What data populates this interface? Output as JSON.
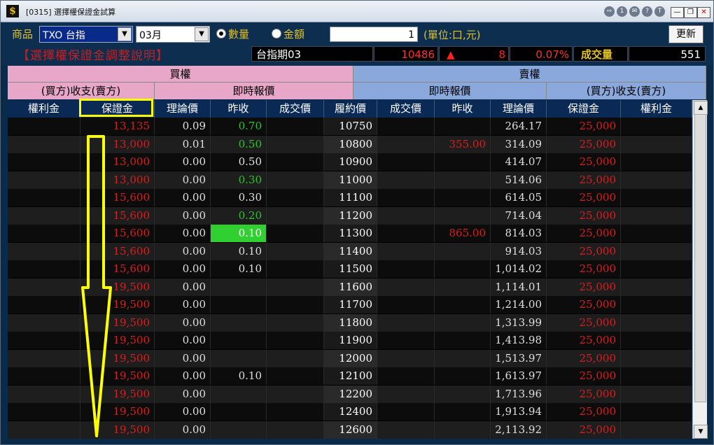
{
  "window": {
    "title": "[0315] 選擇權保證金試算",
    "title_buttons": [
      "⇨",
      "1",
      "✉",
      "?",
      "T"
    ],
    "controls": [
      "—",
      "❐",
      "✕"
    ]
  },
  "toolbar": {
    "product_label": "商品",
    "product_value": "TXO 台指",
    "month_value": "03月",
    "radio_qty": "數量",
    "radio_amount": "金額",
    "qty_value": "1",
    "unit_label": "(單位:口,元)",
    "refresh_label": "更新"
  },
  "status": {
    "notice": "【選擇權保證金調整說明】",
    "contract": "台指期03",
    "price": "10486",
    "arrow": "▲",
    "change": "8",
    "pct": "0.07%",
    "vol_label": "成交量",
    "volume": "551"
  },
  "headers": {
    "call": "買權",
    "put": "賣權",
    "call_cash": "(買方)收支(賣方)",
    "call_quote": "即時報價",
    "put_quote": "即時報價",
    "put_cash": "(買方)收支(賣方)"
  },
  "columns": [
    "權利金",
    "保證金",
    "理論價",
    "昨收",
    "成交價",
    "履約價",
    "成交價",
    "昨收",
    "理論價",
    "保證金",
    "權利金"
  ],
  "rows": [
    {
      "c_margin": "13,135",
      "c_theo": "0.09",
      "c_prev": "0.70",
      "c_last": "",
      "strike": "10750",
      "p_last": "",
      "p_prev": "",
      "p_theo": "264.17",
      "p_margin": "25,000"
    },
    {
      "c_margin": "13,000",
      "c_theo": "0.01",
      "c_prev": "0.50",
      "c_last": "",
      "strike": "10800",
      "p_last": "",
      "p_prev": "355.00",
      "p_theo": "314.09",
      "p_margin": "25,000"
    },
    {
      "c_margin": "13,000",
      "c_theo": "0.00",
      "c_prev": "0.50",
      "c_last": "",
      "strike": "10900",
      "p_last": "",
      "p_prev": "",
      "p_theo": "414.07",
      "p_margin": "25,000"
    },
    {
      "c_margin": "13,000",
      "c_theo": "0.00",
      "c_prev": "0.30",
      "c_last": "",
      "strike": "11000",
      "p_last": "",
      "p_prev": "",
      "p_theo": "514.06",
      "p_margin": "25,000"
    },
    {
      "c_margin": "15,600",
      "c_theo": "0.00",
      "c_prev": "0.30",
      "c_last": "",
      "strike": "11100",
      "p_last": "",
      "p_prev": "",
      "p_theo": "614.05",
      "p_margin": "25,000"
    },
    {
      "c_margin": "15,600",
      "c_theo": "0.00",
      "c_prev": "0.20",
      "c_last": "",
      "strike": "11200",
      "p_last": "",
      "p_prev": "",
      "p_theo": "714.04",
      "p_margin": "25,000"
    },
    {
      "c_margin": "15,600",
      "c_theo": "0.00",
      "c_prev": "0.10",
      "c_last": "",
      "strike": "11300",
      "p_last": "",
      "p_prev": "865.00",
      "p_theo": "814.03",
      "p_margin": "25,000"
    },
    {
      "c_margin": "15,600",
      "c_theo": "0.00",
      "c_prev": "0.10",
      "c_last": "",
      "strike": "11400",
      "p_last": "",
      "p_prev": "",
      "p_theo": "914.03",
      "p_margin": "25,000"
    },
    {
      "c_margin": "15,600",
      "c_theo": "0.00",
      "c_prev": "0.10",
      "c_last": "",
      "strike": "11500",
      "p_last": "",
      "p_prev": "",
      "p_theo": "1,014.02",
      "p_margin": "25,000"
    },
    {
      "c_margin": "19,500",
      "c_theo": "0.00",
      "c_prev": "",
      "c_last": "",
      "strike": "11600",
      "p_last": "",
      "p_prev": "",
      "p_theo": "1,114.01",
      "p_margin": "25,000"
    },
    {
      "c_margin": "19,500",
      "c_theo": "0.00",
      "c_prev": "",
      "c_last": "",
      "strike": "11700",
      "p_last": "",
      "p_prev": "",
      "p_theo": "1,214.00",
      "p_margin": "25,000"
    },
    {
      "c_margin": "19,500",
      "c_theo": "0.00",
      "c_prev": "",
      "c_last": "",
      "strike": "11800",
      "p_last": "",
      "p_prev": "",
      "p_theo": "1,313.99",
      "p_margin": "25,000"
    },
    {
      "c_margin": "19,500",
      "c_theo": "0.00",
      "c_prev": "",
      "c_last": "",
      "strike": "11900",
      "p_last": "",
      "p_prev": "",
      "p_theo": "1,413.98",
      "p_margin": "25,000"
    },
    {
      "c_margin": "19,500",
      "c_theo": "0.00",
      "c_prev": "",
      "c_last": "",
      "strike": "12000",
      "p_last": "",
      "p_prev": "",
      "p_theo": "1,513.97",
      "p_margin": "25,000"
    },
    {
      "c_margin": "19,500",
      "c_theo": "0.00",
      "c_prev": "0.10",
      "c_last": "",
      "strike": "12100",
      "p_last": "",
      "p_prev": "",
      "p_theo": "1,613.97",
      "p_margin": "25,000"
    },
    {
      "c_margin": "19,500",
      "c_theo": "0.00",
      "c_prev": "",
      "c_last": "",
      "strike": "12200",
      "p_last": "",
      "p_prev": "",
      "p_theo": "1,713.96",
      "p_margin": "25,000"
    },
    {
      "c_margin": "19,500",
      "c_theo": "0.00",
      "c_prev": "",
      "c_last": "",
      "strike": "12400",
      "p_last": "",
      "p_prev": "",
      "p_theo": "1,913.94",
      "p_margin": "25,000"
    },
    {
      "c_margin": "19,500",
      "c_theo": "0.00",
      "c_prev": "",
      "c_last": "",
      "strike": "12600",
      "p_last": "",
      "p_prev": "",
      "p_theo": "2,113.92",
      "p_margin": "25,000"
    }
  ],
  "colors": {
    "margin": "#d42020",
    "green_prev": "#30c030",
    "neutral": "#e0e0e0",
    "highlight_cell": "#30d030",
    "strike": "#ffffff",
    "annotation": "#ffff00"
  }
}
